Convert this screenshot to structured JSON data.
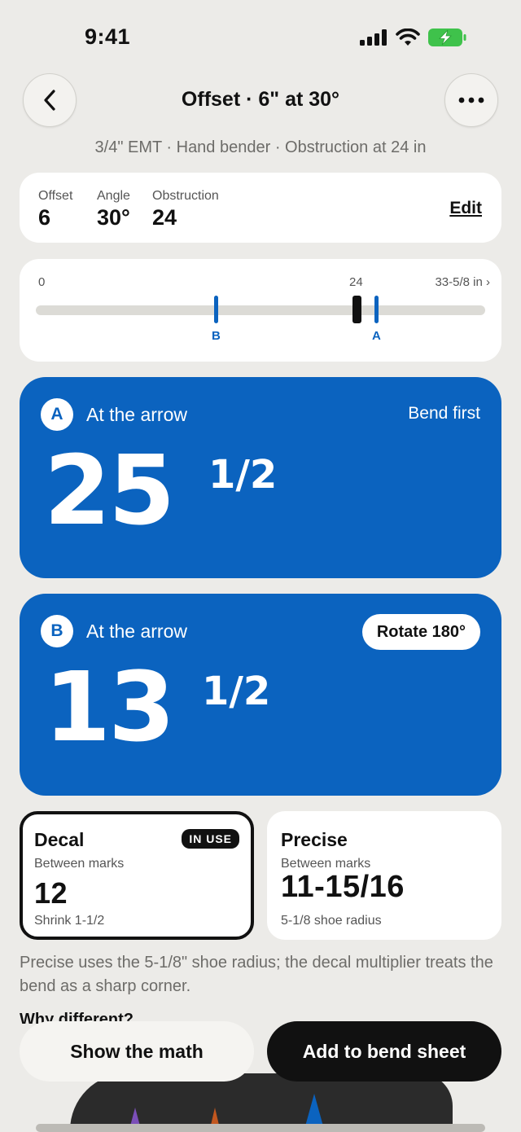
{
  "status": {
    "time": "9:41"
  },
  "nav": {
    "title": "Offset · 6\" at 30°"
  },
  "subtitle": "3/4\" EMT · Hand bender · Obstruction at 24 in",
  "params": {
    "offset_label": "Offset",
    "offset_value": "6",
    "angle_label": "Angle",
    "angle_value": "30°",
    "obstruction_label": "Obstruction",
    "obstruction_value": "24",
    "edit_label": "Edit"
  },
  "ruler": {
    "start": "0",
    "obstruction_tick": "24",
    "end": "33-5/8 in ›",
    "mark_b": "B",
    "mark_a": "A"
  },
  "bend_a": {
    "badge": "A",
    "label": "At the arrow",
    "hint": "Bend first",
    "whole": "25",
    "fraction": "1/2"
  },
  "bend_b": {
    "badge": "B",
    "label": "At the arrow",
    "hint": "Rotate 180°",
    "whole": "13",
    "fraction": "1/2"
  },
  "methods": {
    "decal": {
      "title": "Decal",
      "badge": "IN USE",
      "sub": "Between marks",
      "value": "12",
      "note": "Shrink 1-1/2"
    },
    "precise": {
      "title": "Precise",
      "sub": "Between marks",
      "value": "11-15/16",
      "note": "5-1/8 shoe radius"
    }
  },
  "explain": "Precise uses the 5-1/8\" shoe radius; the decal multiplier treats the bend as a sharp corner.",
  "why_heading": "Why different?",
  "actions": {
    "show_math": "Show the math",
    "add_sheet": "Add to bend sheet"
  },
  "colors": {
    "accent": "#0b63bf",
    "background": "#ecebe8",
    "dark": "#111111"
  }
}
